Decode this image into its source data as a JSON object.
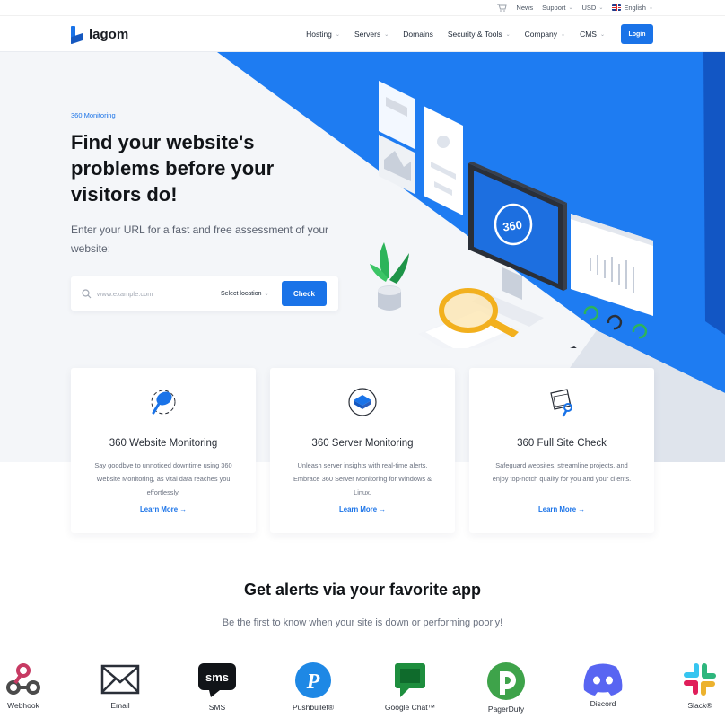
{
  "topbar": {
    "news": "News",
    "support": "Support",
    "currency": "USD",
    "language": "English"
  },
  "nav": {
    "logo_text": "lagom",
    "items": [
      {
        "label": "Hosting",
        "has_caret": true
      },
      {
        "label": "Servers",
        "has_caret": true
      },
      {
        "label": "Domains",
        "has_caret": false
      },
      {
        "label": "Security & Tools",
        "has_caret": true
      },
      {
        "label": "Company",
        "has_caret": true
      },
      {
        "label": "CMS",
        "has_caret": true
      }
    ],
    "login_label": "Login"
  },
  "hero": {
    "eyebrow": "360 Monitoring",
    "headline": "Find your website's problems before your visitors do!",
    "lead": "Enter your URL for a fast and free assessment of your website:",
    "search_placeholder": "www.example.com",
    "location_label": "Select location",
    "check_label": "Check",
    "illustration_logo_text": "360"
  },
  "cards": [
    {
      "title": "360 Website Monitoring",
      "text": "Say goodbye to unnoticed downtime using 360 Website Monitoring, as vital data reaches you effortlessly.",
      "link": "Learn More"
    },
    {
      "title": "360 Server Monitoring",
      "text": "Unleash server insights with real-time alerts. Embrace 360 Server Monitoring for Windows & Linux.",
      "link": "Learn More"
    },
    {
      "title": "360 Full Site Check",
      "text": "Safeguard websites, streamline projects, and enjoy top-notch quality for you and your clients.",
      "link": "Learn More"
    }
  ],
  "alerts": {
    "title": "Get alerts via your favorite app",
    "subtitle": "Be the first to know when your site is down or performing poorly!",
    "apps": [
      {
        "label": "Webhook",
        "icon": "webhook-icon"
      },
      {
        "label": "Email",
        "icon": "email-icon"
      },
      {
        "label": "SMS",
        "icon": "sms-icon"
      },
      {
        "label": "Pushbullet®",
        "icon": "pushbullet-icon"
      },
      {
        "label": "Google Chat™",
        "icon": "google-chat-icon"
      },
      {
        "label": "PagerDuty",
        "icon": "pagerduty-icon"
      },
      {
        "label": "Discord",
        "icon": "discord-icon"
      },
      {
        "label": "Slack®",
        "icon": "slack-icon"
      }
    ]
  },
  "colors": {
    "brand_blue": "#1a73e8",
    "hero_blue": "#1e7cf2",
    "google_chat_green": "#1e8e3e",
    "pagerduty_green": "#3ea34a",
    "discord_purple": "#5865f2"
  }
}
